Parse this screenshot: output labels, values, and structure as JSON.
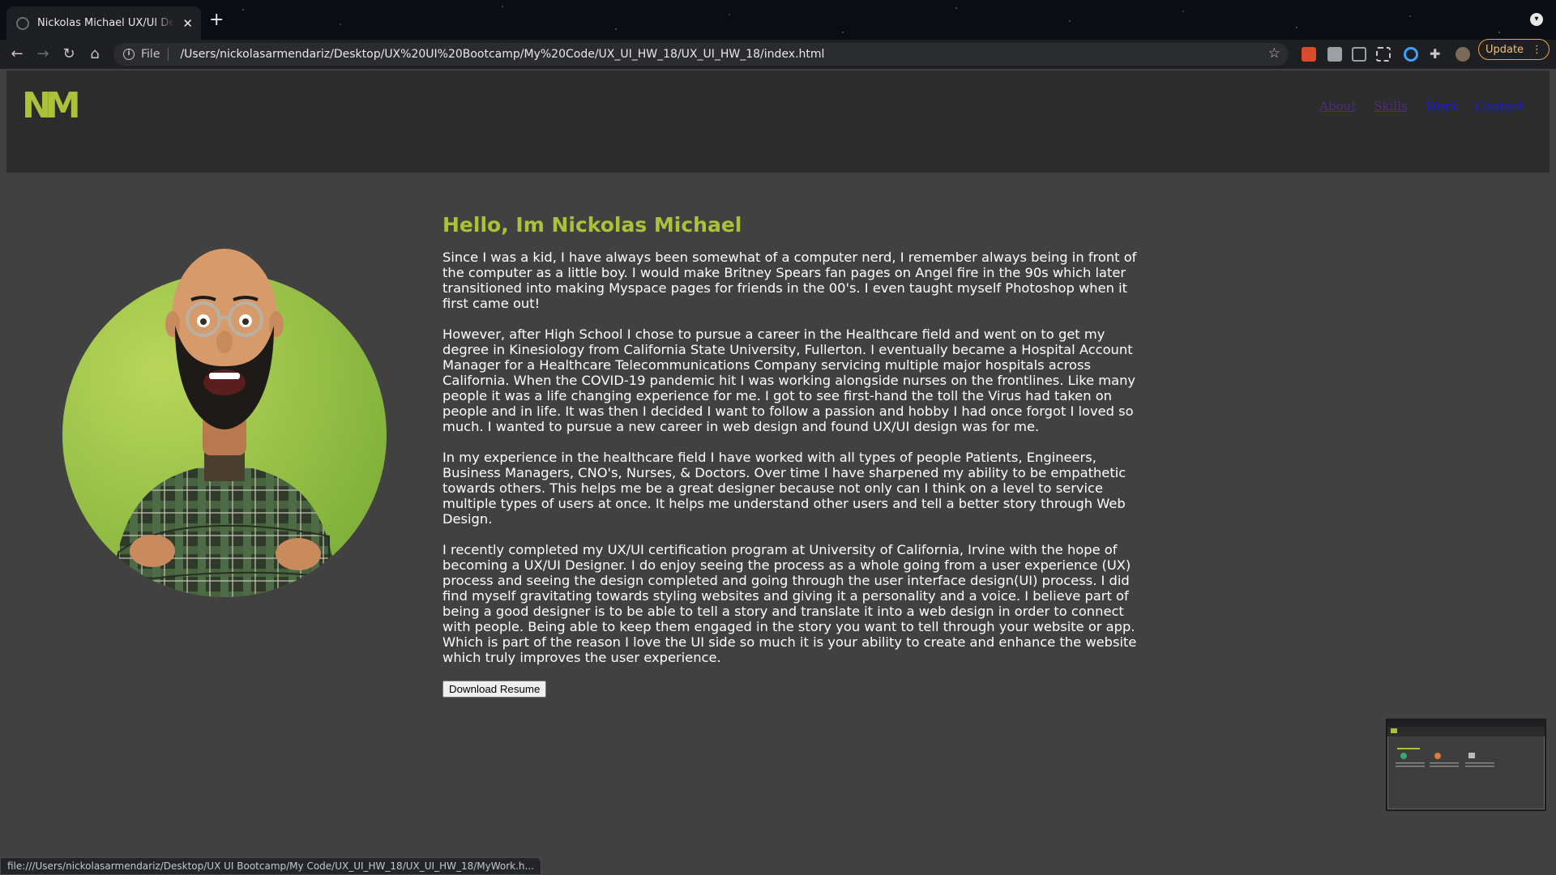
{
  "browser": {
    "tab_title": "Nickolas Michael UX/UI Design",
    "tab_close": "✕",
    "new_tab": "+",
    "url_scheme": "File",
    "url": "/Users/nickolasarmendariz/Desktop/UX%20UI%20Bootcamp/My%20Code/UX_UI_HW_18/UX_UI_HW_18/index.html",
    "update_label": "Update",
    "status_url": "file:///Users/nickolasarmendariz/Desktop/UX UI Bootcamp/My Code/UX_UI_HW_18/UX_UI_HW_18/MyWork.h..."
  },
  "site": {
    "logo": "NM",
    "nav": [
      {
        "label": "About",
        "state": "visited"
      },
      {
        "label": "Skills",
        "state": "visited"
      },
      {
        "label": "Work",
        "state": "link"
      },
      {
        "label": "Contact",
        "state": "link"
      }
    ],
    "heading": "Hello, Im Nickolas Michael",
    "paragraphs": [
      "Since I was a kid, I have always been somewhat of a computer nerd, I remember always being in front of the computer as a little boy. I would make Britney Spears fan pages on Angel fire in the 90s which later transitioned into making Myspace pages for friends in the 00's. I even taught myself Photoshop when it first came out!",
      "However, after High School I chose to pursue a career in the Healthcare field and went on to get my degree in Kinesiology from California State University, Fullerton. I eventually became a Hospital Account Manager for a Healthcare Telecommunications Company servicing multiple major hospitals across California. When the COVID-19 pandemic hit I was working alongside nurses on the frontlines. Like many people it was a life changing experience for me. I got to see first-hand the toll the Virus had taken on people and in life. It was then I decided I want to follow a passion and hobby I had once forgot I loved so much. I wanted to pursue a new career in web design and found UX/UI design was for me.",
      "In my experience in the healthcare field I have worked with all types of people Patients, Engineers, Business Managers, CNO's, Nurses, & Doctors. Over time I have sharpened my ability to be empathetic towards others. This helps me be a great designer because not only can I think on a level to service multiple types of users at once. It helps me understand other users and tell a better story through Web Design.",
      "I recently completed my UX/UI certification program at University of California, Irvine with the hope of becoming a UX/UI Designer. I do enjoy seeing the process as a whole going from a user experience (UX) process and seeing the design completed and going through the user interface design(UI) process. I did find myself gravitating towards styling websites and giving it a personality and a voice. I believe part of being a good designer is to be able to tell a story and translate it into a web design in order to connect with people. Being able to keep them engaged in the story you want to tell through your website or app. Which is part of the reason I love the UI side so much it is your ability to create and enhance the website which truly improves the user experience."
    ],
    "resume_button": "Download Resume"
  },
  "colors": {
    "accent": "#a9c23a",
    "page_bg": "#414141",
    "header_bg": "#2c2c2c",
    "visited_link": "#4e2d80",
    "link": "#1a1adb"
  }
}
